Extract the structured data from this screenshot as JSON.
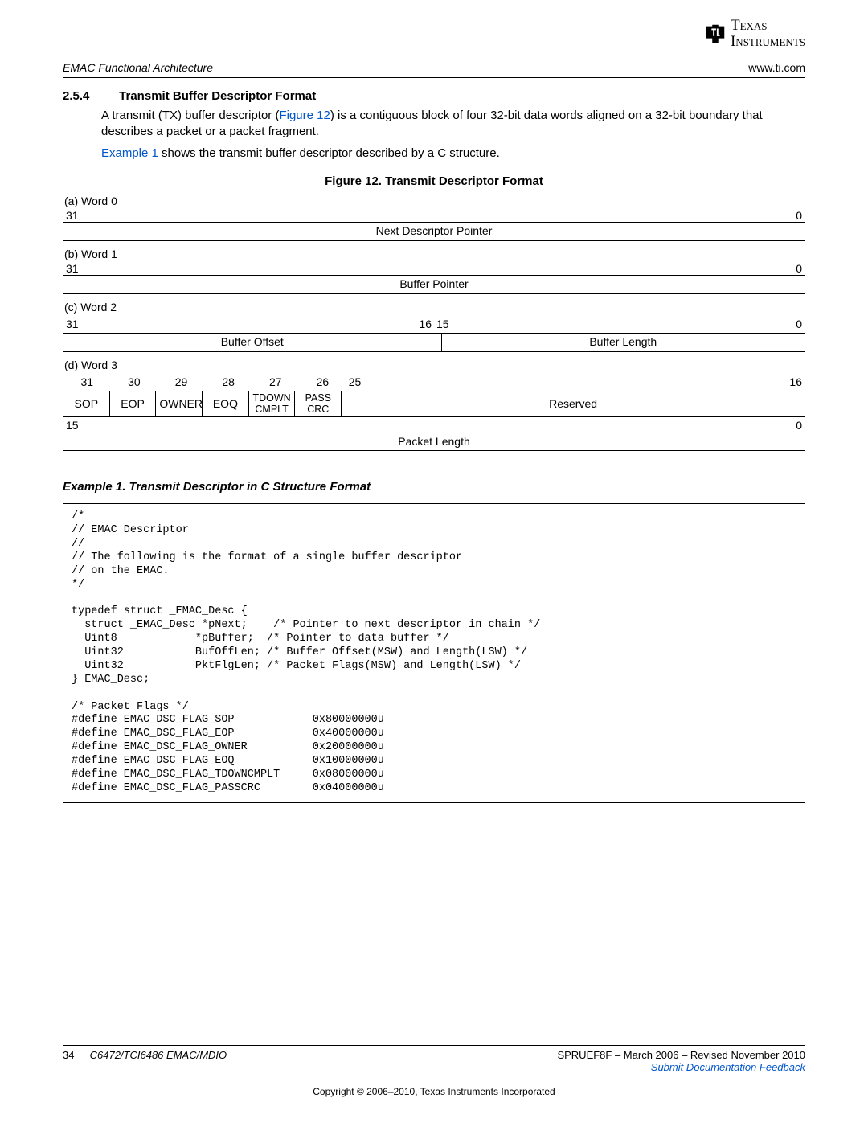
{
  "header": {
    "logo_line1": "Texas",
    "logo_line2": "Instruments",
    "running_left": "EMAC Functional Architecture",
    "running_right": "www.ti.com"
  },
  "section": {
    "number": "2.5.4",
    "title": "Transmit Buffer Descriptor Format",
    "para1_a": "A transmit (TX) buffer descriptor (",
    "para1_link": "Figure 12",
    "para1_b": ") is a contiguous block of four 32-bit data words aligned on a 32-bit boundary that describes a packet or a packet fragment.",
    "para2_link": "Example 1",
    "para2_b": " shows the transmit buffer descriptor described by a C structure."
  },
  "figure": {
    "caption": "Figure 12. Transmit Descriptor Format",
    "word0": {
      "label": "(a) Word 0",
      "bit_hi": "31",
      "bit_lo": "0",
      "cell": "Next Descriptor Pointer"
    },
    "word1": {
      "label": "(b) Word 1",
      "bit_hi": "31",
      "bit_lo": "0",
      "cell": "Buffer Pointer"
    },
    "word2": {
      "label": "(c) Word 2",
      "bit_a": "31",
      "bit_b": "16",
      "bit_c": "15",
      "bit_d": "0",
      "cell_left": "Buffer Offset",
      "cell_right": "Buffer Length"
    },
    "word3": {
      "label": "(d) Word 3",
      "bits_top": [
        "31",
        "30",
        "29",
        "28",
        "27",
        "26",
        "25",
        "16"
      ],
      "flags": [
        "SOP",
        "EOP",
        "OWNER",
        "EOQ",
        "TDOWN CMPLT",
        "PASS CRC",
        "Reserved"
      ],
      "bit_hi2": "15",
      "bit_lo2": "0",
      "cell_bottom": "Packet Length"
    }
  },
  "example": {
    "caption": "Example 1. Transmit Descriptor in C Structure Format",
    "code": "/*\n// EMAC Descriptor\n//\n// The following is the format of a single buffer descriptor\n// on the EMAC.\n*/\n\ntypedef struct _EMAC_Desc {\n  struct _EMAC_Desc *pNext;    /* Pointer to next descriptor in chain */\n  Uint8            *pBuffer;  /* Pointer to data buffer */\n  Uint32           BufOffLen; /* Buffer Offset(MSW) and Length(LSW) */\n  Uint32           PktFlgLen; /* Packet Flags(MSW) and Length(LSW) */\n} EMAC_Desc;\n\n/* Packet Flags */\n#define EMAC_DSC_FLAG_SOP            0x80000000u\n#define EMAC_DSC_FLAG_EOP            0x40000000u\n#define EMAC_DSC_FLAG_OWNER          0x20000000u\n#define EMAC_DSC_FLAG_EOQ            0x10000000u\n#define EMAC_DSC_FLAG_TDOWNCMPLT     0x08000000u\n#define EMAC_DSC_FLAG_PASSCRC        0x04000000u"
  },
  "footer": {
    "page_num": "34",
    "doc_title": "C6472/TCI6486 EMAC/MDIO",
    "doc_rev": "SPRUEF8F – March 2006 – Revised November 2010",
    "feedback": "Submit Documentation Feedback",
    "copyright": "Copyright © 2006–2010, Texas Instruments Incorporated"
  }
}
